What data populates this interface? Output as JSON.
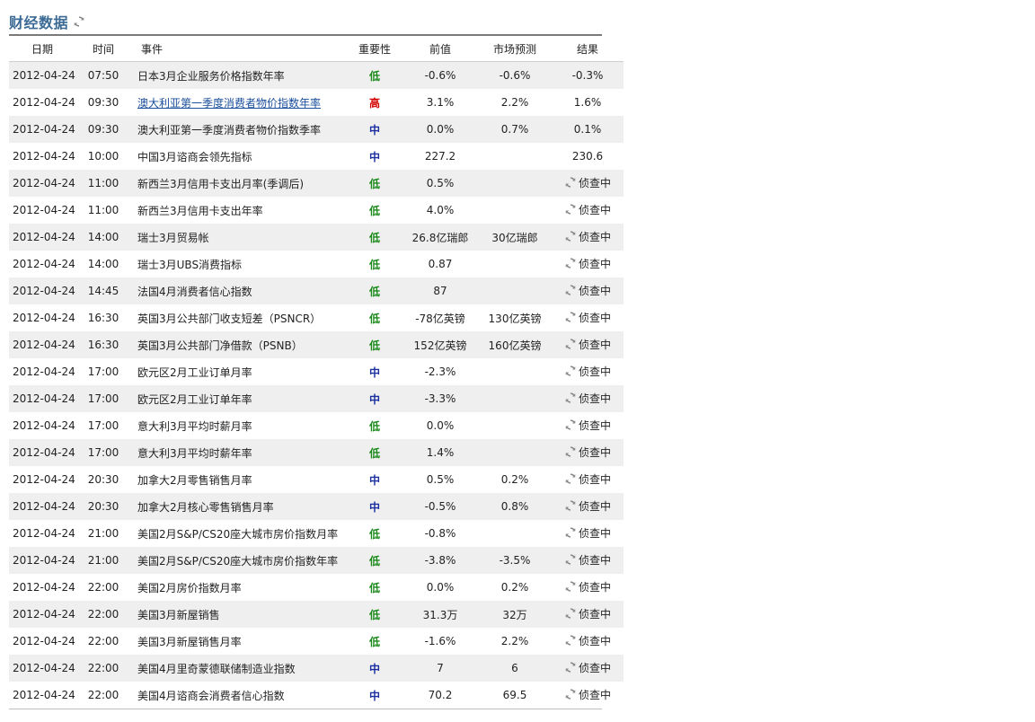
{
  "header": {
    "title": "财经数据",
    "refresh_icon": "refresh-icon"
  },
  "colors": {
    "title": "#3a6a95",
    "importance_low": "#1a8a1a",
    "importance_mid": "#1a2fa0",
    "importance_high": "#d20000",
    "row_alt": "#efefef"
  },
  "table": {
    "columns": [
      "日期",
      "时间",
      "事件",
      "重要性",
      "前值",
      "市场预测",
      "结果"
    ],
    "rows": [
      {
        "date": "2012-04-24",
        "time": "07:50",
        "event": "日本3月企业服务价格指数年率",
        "importance": "低",
        "level": "low",
        "previous": "-0.6%",
        "forecast": "-0.6%",
        "result": "-0.3%",
        "pending": false,
        "link": false
      },
      {
        "date": "2012-04-24",
        "time": "09:30",
        "event": "澳大利亚第一季度消费者物价指数年率",
        "importance": "高",
        "level": "high",
        "previous": "3.1%",
        "forecast": "2.2%",
        "result": "1.6%",
        "pending": false,
        "link": true
      },
      {
        "date": "2012-04-24",
        "time": "09:30",
        "event": "澳大利亚第一季度消费者物价指数季率",
        "importance": "中",
        "level": "mid",
        "previous": "0.0%",
        "forecast": "0.7%",
        "result": "0.1%",
        "pending": false,
        "link": false
      },
      {
        "date": "2012-04-24",
        "time": "10:00",
        "event": "中国3月谘商会领先指标",
        "importance": "中",
        "level": "mid",
        "previous": "227.2",
        "forecast": "",
        "result": "230.6",
        "pending": false,
        "link": false
      },
      {
        "date": "2012-04-24",
        "time": "11:00",
        "event": "新西兰3月信用卡支出月率(季调后)",
        "importance": "低",
        "level": "low",
        "previous": "0.5%",
        "forecast": "",
        "result": "侦查中",
        "pending": true,
        "link": false
      },
      {
        "date": "2012-04-24",
        "time": "11:00",
        "event": "新西兰3月信用卡支出年率",
        "importance": "低",
        "level": "low",
        "previous": "4.0%",
        "forecast": "",
        "result": "侦查中",
        "pending": true,
        "link": false
      },
      {
        "date": "2012-04-24",
        "time": "14:00",
        "event": "瑞士3月贸易帐",
        "importance": "低",
        "level": "low",
        "previous": "26.8亿瑞郎",
        "forecast": "30亿瑞郎",
        "result": "侦查中",
        "pending": true,
        "link": false
      },
      {
        "date": "2012-04-24",
        "time": "14:00",
        "event": "瑞士3月UBS消费指标",
        "importance": "低",
        "level": "low",
        "previous": "0.87",
        "forecast": "",
        "result": "侦查中",
        "pending": true,
        "link": false
      },
      {
        "date": "2012-04-24",
        "time": "14:45",
        "event": "法国4月消费者信心指数",
        "importance": "低",
        "level": "low",
        "previous": "87",
        "forecast": "",
        "result": "侦查中",
        "pending": true,
        "link": false
      },
      {
        "date": "2012-04-24",
        "time": "16:30",
        "event": "英国3月公共部门收支短差（PSNCR）",
        "importance": "低",
        "level": "low",
        "previous": "-78亿英镑",
        "forecast": "130亿英镑",
        "result": "侦查中",
        "pending": true,
        "link": false
      },
      {
        "date": "2012-04-24",
        "time": "16:30",
        "event": "英国3月公共部门净借款（PSNB）",
        "importance": "低",
        "level": "low",
        "previous": "152亿英镑",
        "forecast": "160亿英镑",
        "result": "侦查中",
        "pending": true,
        "link": false
      },
      {
        "date": "2012-04-24",
        "time": "17:00",
        "event": "欧元区2月工业订单月率",
        "importance": "中",
        "level": "mid",
        "previous": "-2.3%",
        "forecast": "",
        "result": "侦查中",
        "pending": true,
        "link": false
      },
      {
        "date": "2012-04-24",
        "time": "17:00",
        "event": "欧元区2月工业订单年率",
        "importance": "中",
        "level": "mid",
        "previous": "-3.3%",
        "forecast": "",
        "result": "侦查中",
        "pending": true,
        "link": false
      },
      {
        "date": "2012-04-24",
        "time": "17:00",
        "event": "意大利3月平均时薪月率",
        "importance": "低",
        "level": "low",
        "previous": "0.0%",
        "forecast": "",
        "result": "侦查中",
        "pending": true,
        "link": false
      },
      {
        "date": "2012-04-24",
        "time": "17:00",
        "event": "意大利3月平均时薪年率",
        "importance": "低",
        "level": "low",
        "previous": "1.4%",
        "forecast": "",
        "result": "侦查中",
        "pending": true,
        "link": false
      },
      {
        "date": "2012-04-24",
        "time": "20:30",
        "event": "加拿大2月零售销售月率",
        "importance": "中",
        "level": "mid",
        "previous": "0.5%",
        "forecast": "0.2%",
        "result": "侦查中",
        "pending": true,
        "link": false
      },
      {
        "date": "2012-04-24",
        "time": "20:30",
        "event": "加拿大2月核心零售销售月率",
        "importance": "中",
        "level": "mid",
        "previous": "-0.5%",
        "forecast": "0.8%",
        "result": "侦查中",
        "pending": true,
        "link": false
      },
      {
        "date": "2012-04-24",
        "time": "21:00",
        "event": "美国2月S&P/CS20座大城市房价指数月率",
        "importance": "低",
        "level": "low",
        "previous": "-0.8%",
        "forecast": "",
        "result": "侦查中",
        "pending": true,
        "link": false
      },
      {
        "date": "2012-04-24",
        "time": "21:00",
        "event": "美国2月S&P/CS20座大城市房价指数年率",
        "importance": "低",
        "level": "low",
        "previous": "-3.8%",
        "forecast": "-3.5%",
        "result": "侦查中",
        "pending": true,
        "link": false
      },
      {
        "date": "2012-04-24",
        "time": "22:00",
        "event": "美国2月房价指数月率",
        "importance": "低",
        "level": "low",
        "previous": "0.0%",
        "forecast": "0.2%",
        "result": "侦查中",
        "pending": true,
        "link": false
      },
      {
        "date": "2012-04-24",
        "time": "22:00",
        "event": "美国3月新屋销售",
        "importance": "低",
        "level": "low",
        "previous": "31.3万",
        "forecast": "32万",
        "result": "侦查中",
        "pending": true,
        "link": false
      },
      {
        "date": "2012-04-24",
        "time": "22:00",
        "event": "美国3月新屋销售月率",
        "importance": "低",
        "level": "low",
        "previous": "-1.6%",
        "forecast": "2.2%",
        "result": "侦查中",
        "pending": true,
        "link": false
      },
      {
        "date": "2012-04-24",
        "time": "22:00",
        "event": "美国4月里奇蒙德联储制造业指数",
        "importance": "中",
        "level": "mid",
        "previous": "7",
        "forecast": "6",
        "result": "侦查中",
        "pending": true,
        "link": false
      },
      {
        "date": "2012-04-24",
        "time": "22:00",
        "event": "美国4月谘商会消费者信心指数",
        "importance": "中",
        "level": "mid",
        "previous": "70.2",
        "forecast": "69.5",
        "result": "侦查中",
        "pending": true,
        "link": false
      }
    ]
  }
}
